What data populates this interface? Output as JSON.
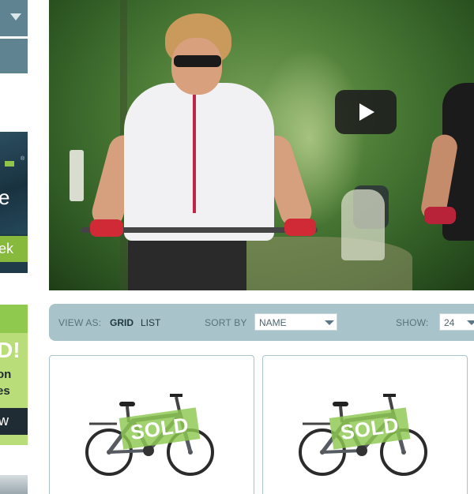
{
  "sidebar": {
    "ad1": {
      "word": "e",
      "button_label": "ek"
    },
    "ad2": {
      "headline": "D!",
      "line1": "on",
      "line2": "es",
      "button_label": "w"
    }
  },
  "video": {
    "play_icon": "play-icon"
  },
  "toolbar": {
    "view_as_label": "VIEW AS:",
    "view_grid": "GRID",
    "view_list": "LIST",
    "sort_label": "SORT BY",
    "sort_value": "NAME",
    "show_label": "SHOW:",
    "show_value": "24"
  },
  "products": [
    {
      "badge": "SOLD"
    },
    {
      "badge": "SOLD"
    }
  ],
  "colors": {
    "toolbar_bg": "#a9c3cb",
    "accent_green": "#8dc850",
    "sidebar_blue": "#5f8390"
  }
}
